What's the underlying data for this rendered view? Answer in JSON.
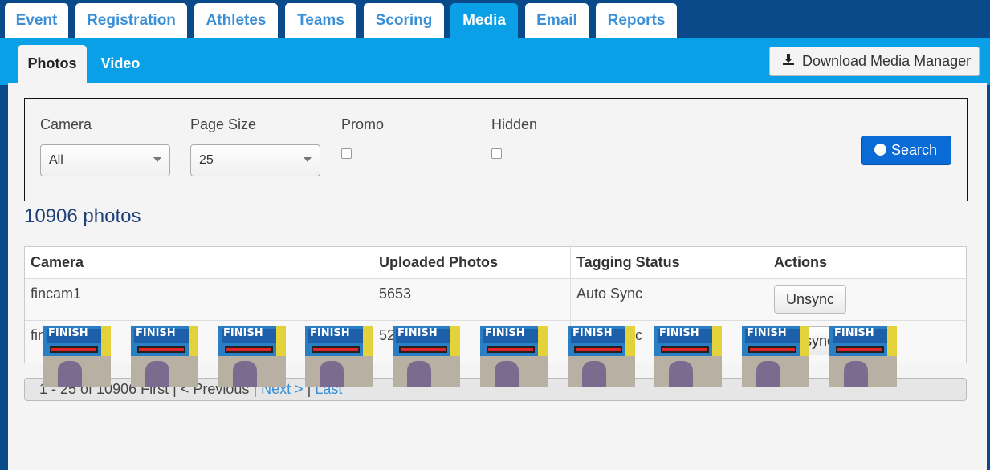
{
  "top_tabs": [
    {
      "label": "Event",
      "active": false
    },
    {
      "label": "Registration",
      "active": false
    },
    {
      "label": "Athletes",
      "active": false
    },
    {
      "label": "Teams",
      "active": false
    },
    {
      "label": "Scoring",
      "active": false
    },
    {
      "label": "Media",
      "active": true
    },
    {
      "label": "Email",
      "active": false
    },
    {
      "label": "Reports",
      "active": false
    }
  ],
  "sub_tabs": [
    {
      "label": "Photos",
      "active": true
    },
    {
      "label": "Video",
      "active": false
    }
  ],
  "download_button": {
    "label": "Download Media Manager",
    "icon": "download-icon"
  },
  "filters": {
    "camera_label": "Camera",
    "camera_value": "All",
    "page_size_label": "Page Size",
    "page_size_value": "25",
    "promo_label": "Promo",
    "promo_checked": false,
    "hidden_label": "Hidden",
    "hidden_checked": false,
    "search_label": "Search"
  },
  "photo_count": "10906 photos",
  "table": {
    "headers": [
      "Camera",
      "Uploaded Photos",
      "Tagging Status",
      "Actions"
    ],
    "rows": [
      {
        "camera": "fincam1",
        "uploaded": "5653",
        "status": "Auto Sync",
        "action": "Unsync"
      },
      {
        "camera": "fincam2",
        "uploaded": "5253",
        "status": "Auto Sync",
        "action": "Unsync"
      }
    ]
  },
  "pager": {
    "range": "1 - 25 of 10906",
    "first": "First",
    "sep1": "|",
    "previous": "< Previous",
    "sep2": "|",
    "next": "Next >",
    "sep3": "|",
    "last": "Last"
  },
  "thumbnails": [
    {
      "label": "FINISH"
    },
    {
      "label": "FINISH"
    },
    {
      "label": "FINISH"
    },
    {
      "label": "FINISH"
    },
    {
      "label": "FINISH"
    },
    {
      "label": "FINISH"
    },
    {
      "label": "FINISH"
    },
    {
      "label": "FINISH"
    },
    {
      "label": "FINISH"
    },
    {
      "label": "FINISH"
    }
  ],
  "colors": {
    "nav_dark": "#0a4a8a",
    "nav_light": "#0aa0e8",
    "link": "#3a8fd6",
    "primary_button": "#0a6ad6"
  }
}
